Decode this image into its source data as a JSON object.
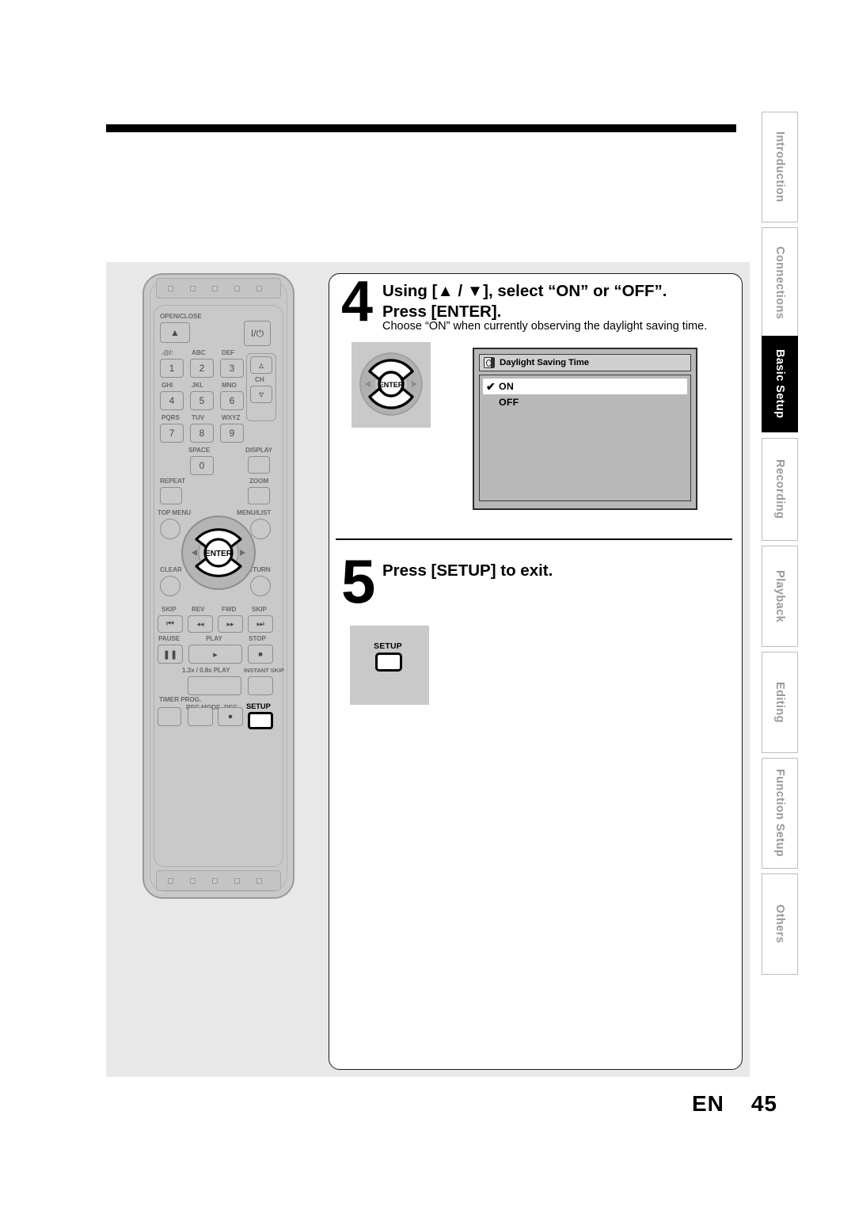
{
  "page": {
    "lang_code": "EN",
    "page_number": "45"
  },
  "steps": [
    {
      "number": "4",
      "heading_line1": "Using [▲ / ▼], select “ON” or “OFF”.",
      "heading_line2": "Press [ENTER].",
      "subtext": "Choose “ON” when currently observing the daylight saving time."
    },
    {
      "number": "5",
      "heading_line1": "Press [SETUP] to exit."
    }
  ],
  "osd": {
    "title": "Daylight Saving Time",
    "title_icon": "clock-icon",
    "options": [
      {
        "label": "ON",
        "selected": true,
        "check": "✔"
      },
      {
        "label": "OFF",
        "selected": false,
        "check": ""
      }
    ]
  },
  "figures": {
    "dpad": {
      "center_label": "ENTER",
      "up": "▲",
      "down": "▼",
      "left": "◄",
      "right": "►"
    },
    "setup_key": {
      "label": "SETUP"
    }
  },
  "remote": {
    "keys": [
      {
        "label": "OPEN/CLOSE",
        "glyph": "▲"
      },
      {
        "label": "",
        "glyph": "I/⏻"
      },
      {
        "label": ".@/:",
        "glyph": "1"
      },
      {
        "label": "ABC",
        "glyph": "2"
      },
      {
        "label": "DEF",
        "glyph": "3"
      },
      {
        "label": "GHI",
        "glyph": "4"
      },
      {
        "label": "JKL",
        "glyph": "5"
      },
      {
        "label": "MNO",
        "glyph": "6"
      },
      {
        "label": "PQRS",
        "glyph": "7"
      },
      {
        "label": "TUV",
        "glyph": "8"
      },
      {
        "label": "WXYZ",
        "glyph": "9"
      },
      {
        "label": "SPACE",
        "glyph": "0"
      },
      {
        "label": "CH",
        "glyph": "⌃"
      },
      {
        "label": "DISPLAY",
        "glyph": ""
      },
      {
        "label": "REPEAT",
        "glyph": ""
      },
      {
        "label": "ZOOM",
        "glyph": ""
      },
      {
        "label": "TOP MENU",
        "glyph": ""
      },
      {
        "label": "MENU/LIST",
        "glyph": ""
      },
      {
        "label": "CLEAR",
        "glyph": ""
      },
      {
        "label": "RETURN",
        "glyph": ""
      },
      {
        "label": "SKIP",
        "glyph": "⏮"
      },
      {
        "label": "REV",
        "glyph": "◄◄"
      },
      {
        "label": "FWD",
        "glyph": "►►"
      },
      {
        "label": "SKIP",
        "glyph": "⏭"
      },
      {
        "label": "PAUSE",
        "glyph": "▐▐"
      },
      {
        "label": "PLAY",
        "glyph": "►"
      },
      {
        "label": "STOP",
        "glyph": "■"
      },
      {
        "label": "1.3x / 0.8x PLAY",
        "glyph": ""
      },
      {
        "label": "INSTANT SKIP",
        "glyph": ""
      },
      {
        "label": "TIMER PROG.",
        "glyph": ""
      },
      {
        "label": "REC MODE",
        "glyph": ""
      },
      {
        "label": "REC",
        "glyph": "●"
      },
      {
        "label": "SETUP",
        "glyph": ""
      }
    ],
    "dpad_center_label": "ENTER"
  },
  "side_tabs": [
    {
      "label": "Introduction",
      "active": false
    },
    {
      "label": "Connections",
      "active": false
    },
    {
      "label": "Basic Setup",
      "active": true
    },
    {
      "label": "Recording",
      "active": false
    },
    {
      "label": "Playback",
      "active": false
    },
    {
      "label": "Editing",
      "active": false
    },
    {
      "label": "Function Setup",
      "active": false
    },
    {
      "label": "Others",
      "active": false
    }
  ],
  "colors": {
    "panel_gray": "#e8e8e8",
    "remote_gray": "#c9c9c9",
    "osd_gray": "#b8b8b8",
    "accent_black": "#000000",
    "tab_inactive_text": "#9a9a9a"
  }
}
